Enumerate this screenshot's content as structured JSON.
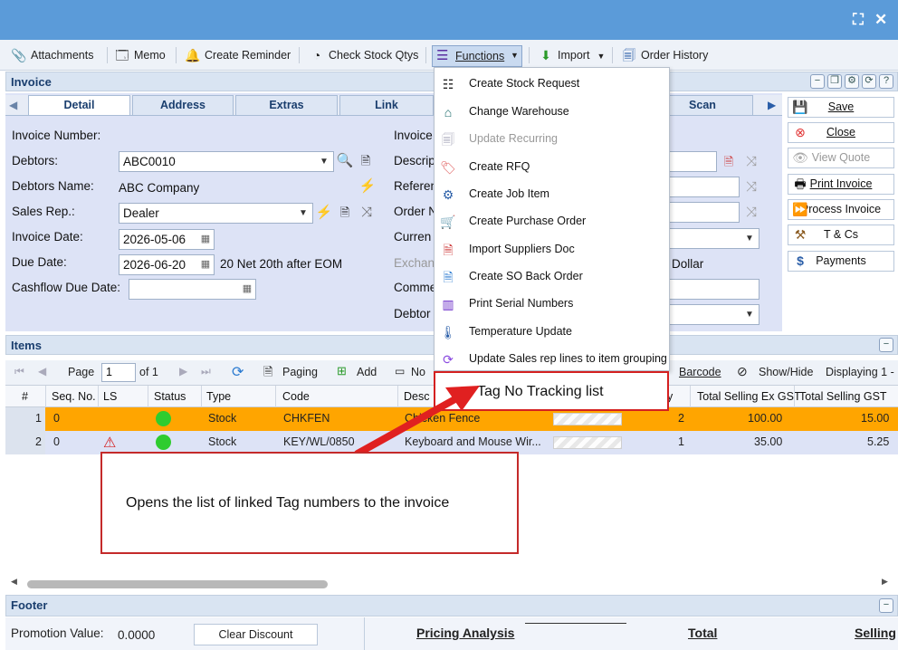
{
  "window": {
    "maximize_icon": "maximize-icon",
    "close_icon": "close-icon"
  },
  "toolbar": {
    "attachments": "Attachments",
    "memo": "Memo",
    "create_reminder": "Create Reminder",
    "check_stock": "Check Stock Qtys",
    "functions": "Functions",
    "import": "Import",
    "order_history": "Order History"
  },
  "invoice": {
    "title": "Invoice",
    "tabs": [
      "Detail",
      "Address",
      "Extras",
      "Link",
      "Scan"
    ],
    "fields": {
      "invoice_number_label": "Invoice Number:",
      "debtors_label": "Debtors:",
      "debtors_value": "ABC0010",
      "debtors_name_label": "Debtors Name:",
      "debtors_name_value": "ABC Company",
      "sales_rep_label": "Sales Rep.:",
      "sales_rep_value": "Dealer",
      "invoice_date_label": "Invoice Date:",
      "invoice_date_value": "2026-05-06",
      "due_date_label": "Due Date:",
      "due_date_value": "2026-06-20",
      "due_terms": "20 Net 20th after EOM",
      "cashflow_label": "Cashflow Due Date:",
      "right_labels": [
        "Invoice",
        "Descrip",
        "Referen",
        "Order N",
        "Curren",
        "Exchan",
        "Comme",
        "Debtor"
      ],
      "currency_suffix": "Dollar"
    }
  },
  "side_buttons": [
    "Save",
    "Close",
    "View Quote",
    "Print Invoice",
    "Process Invoice",
    "T & Cs",
    "Payments"
  ],
  "items": {
    "title": "Items",
    "toolbar": {
      "page_label": "Page",
      "page_value": "1",
      "of_label": "of 1",
      "paging": "Paging",
      "add": "Add",
      "no": "No",
      "barcode": "Barcode",
      "show_hide": "Show/Hide",
      "displaying": "Displaying 1 -"
    },
    "columns": [
      "#",
      "Seq. No.",
      "LS",
      "Status",
      "Type",
      "Code",
      "Desc",
      "y",
      "Total Selling Ex GST",
      "Total Selling GST"
    ],
    "rows": [
      {
        "num": "1",
        "seq": "0",
        "type": "Stock",
        "code": "CHKFEN",
        "desc": "Chicken Fence",
        "qty": "2",
        "ex_gst": "100.00",
        "gst": "15.00"
      },
      {
        "num": "2",
        "seq": "0",
        "type": "Stock",
        "code": "KEY/WL/0850",
        "desc": "Keyboard and Mouse Wir...",
        "qty": "1",
        "ex_gst": "35.00",
        "gst": "5.25"
      }
    ]
  },
  "functions_menu": [
    {
      "label": "Create Stock Request",
      "icon": "stock-request-icon"
    },
    {
      "label": "Change Warehouse",
      "icon": "warehouse-icon"
    },
    {
      "label": "Update Recurring",
      "icon": "recurring-icon",
      "disabled": true
    },
    {
      "label": "Create RFQ",
      "icon": "rfq-tag-icon"
    },
    {
      "label": "Create Job Item",
      "icon": "job-item-icon"
    },
    {
      "label": "Create Purchase Order",
      "icon": "cart-icon"
    },
    {
      "label": "Import Suppliers Doc",
      "icon": "import-doc-icon"
    },
    {
      "label": "Create SO Back Order",
      "icon": "back-order-icon"
    },
    {
      "label": "Print Serial Numbers",
      "icon": "barcode-icon"
    },
    {
      "label": "Temperature Update",
      "icon": "thermometer-icon"
    },
    {
      "label": "Update Sales rep lines to item grouping",
      "icon": "refresh-icon"
    }
  ],
  "highlight": {
    "label": "Tag No Tracking list"
  },
  "callout": {
    "text": "Opens the list of linked Tag numbers to the invoice"
  },
  "footer": {
    "title": "Footer",
    "promotion_label": "Promotion Value:",
    "promotion_value": "0.0000",
    "clear_discount": "Clear Discount",
    "pricing_analysis": "Pricing Analysis",
    "total": "Total",
    "selling": "Selling"
  },
  "colors": {
    "title_bar": "#5b9bd9",
    "row_selected": "#ffa500",
    "annotation_red": "#d42020",
    "status_ok": "#2fcc2f"
  }
}
